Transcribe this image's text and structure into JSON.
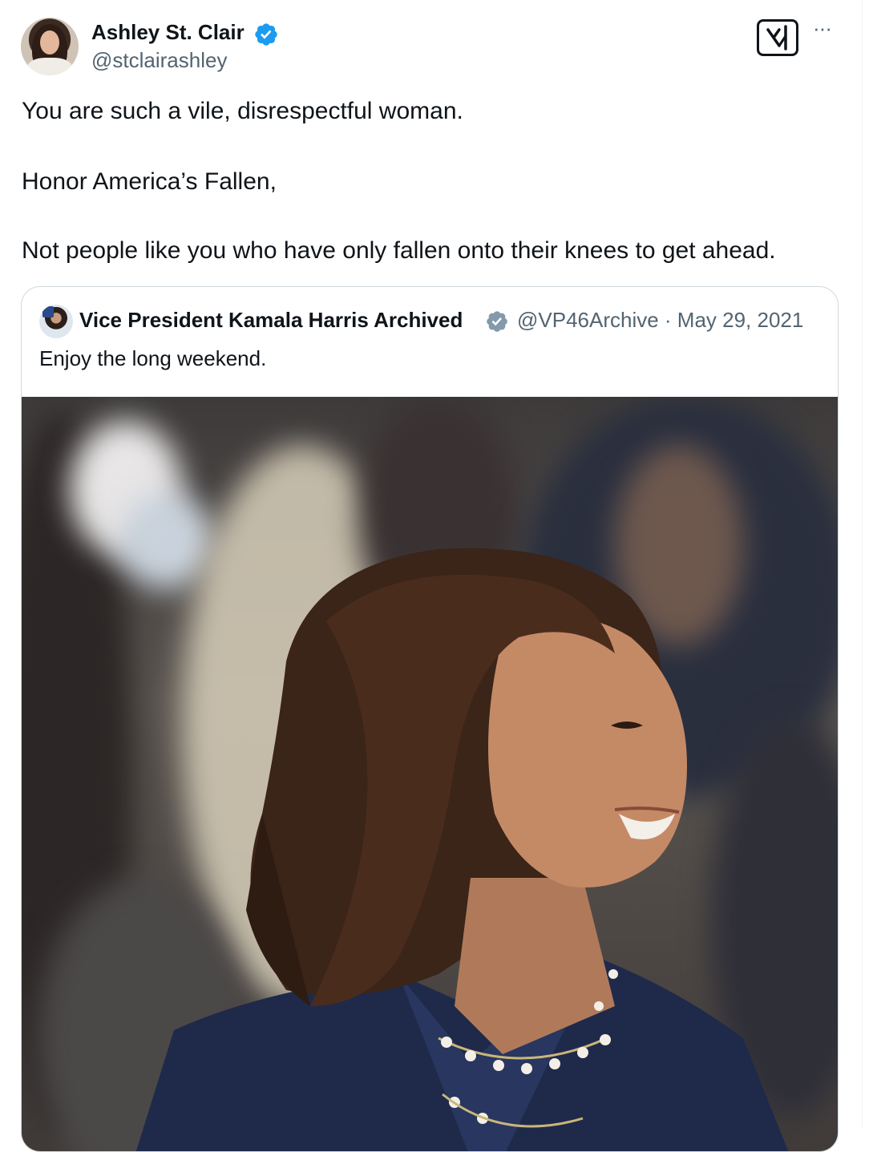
{
  "tweet": {
    "author_name": "Ashley St. Clair",
    "author_handle": "@stclairashley",
    "author_verified": true,
    "verified_color": "#1d9bf0",
    "body_lines": [
      "You are such a vile, disrespectful woman.",
      "Honor America’s Fallen,",
      "Not people like you who have only fallen onto their knees to get ahead."
    ],
    "grok_icon": "grok-logo-icon",
    "more_icon": "more-dots-icon",
    "more_glyph": "···"
  },
  "quoted_tweet": {
    "author_name": "Vice President Kamala Harris Archived",
    "badge": "gray-verified-badge",
    "badge_color": "#829aab",
    "meta": "@VP46Archive · May 29, 2021",
    "text": "Enjoy the long weekend.",
    "media": "photo"
  }
}
